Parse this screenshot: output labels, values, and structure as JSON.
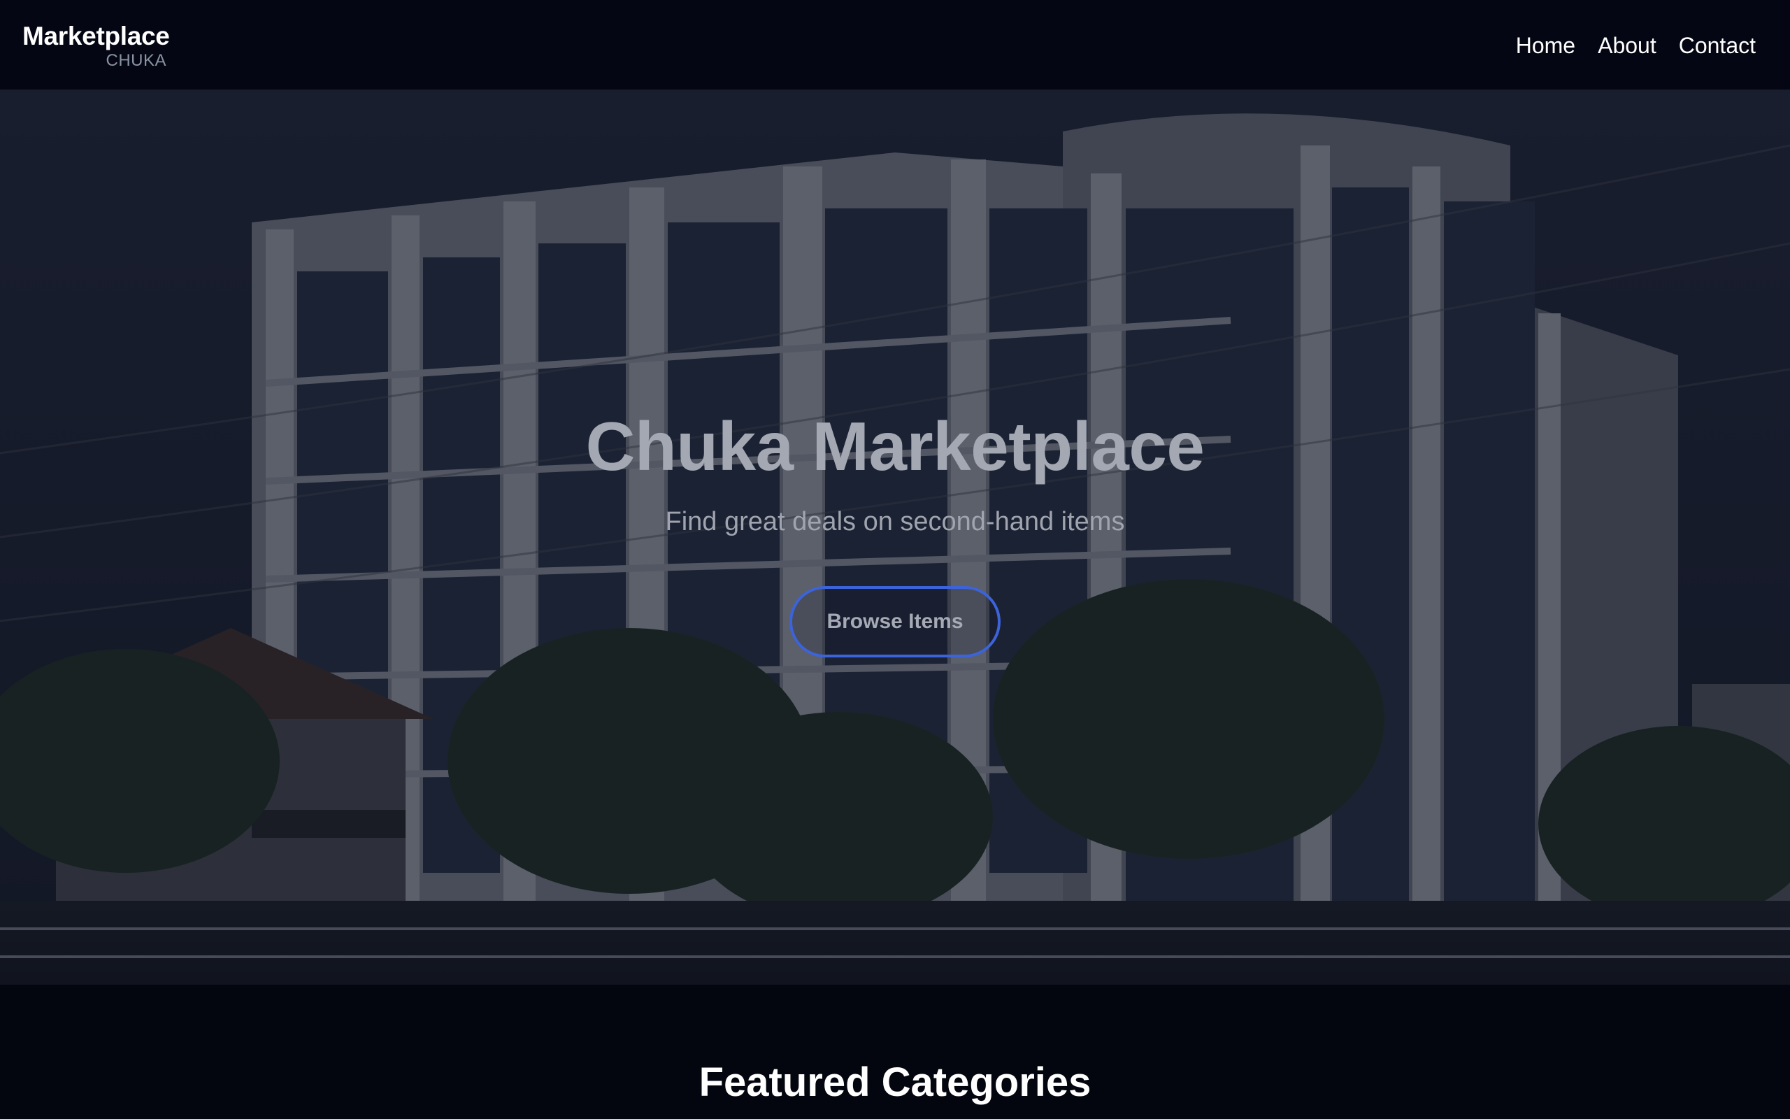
{
  "header": {
    "brand_name": "Marketplace",
    "brand_sub": "CHUKA",
    "nav": [
      {
        "label": "Home"
      },
      {
        "label": "About"
      },
      {
        "label": "Contact"
      }
    ]
  },
  "hero": {
    "title": "Chuka Marketplace",
    "subtitle": "Find great deals on second-hand items",
    "button_label": "Browse Items",
    "image_description_icon": "university-building-photo"
  },
  "featured": {
    "title": "Featured Categories"
  },
  "colors": {
    "background": "#03060f",
    "navbar": "#040713",
    "accent": "#3c63da",
    "hero_text": "#a4a8b3"
  }
}
